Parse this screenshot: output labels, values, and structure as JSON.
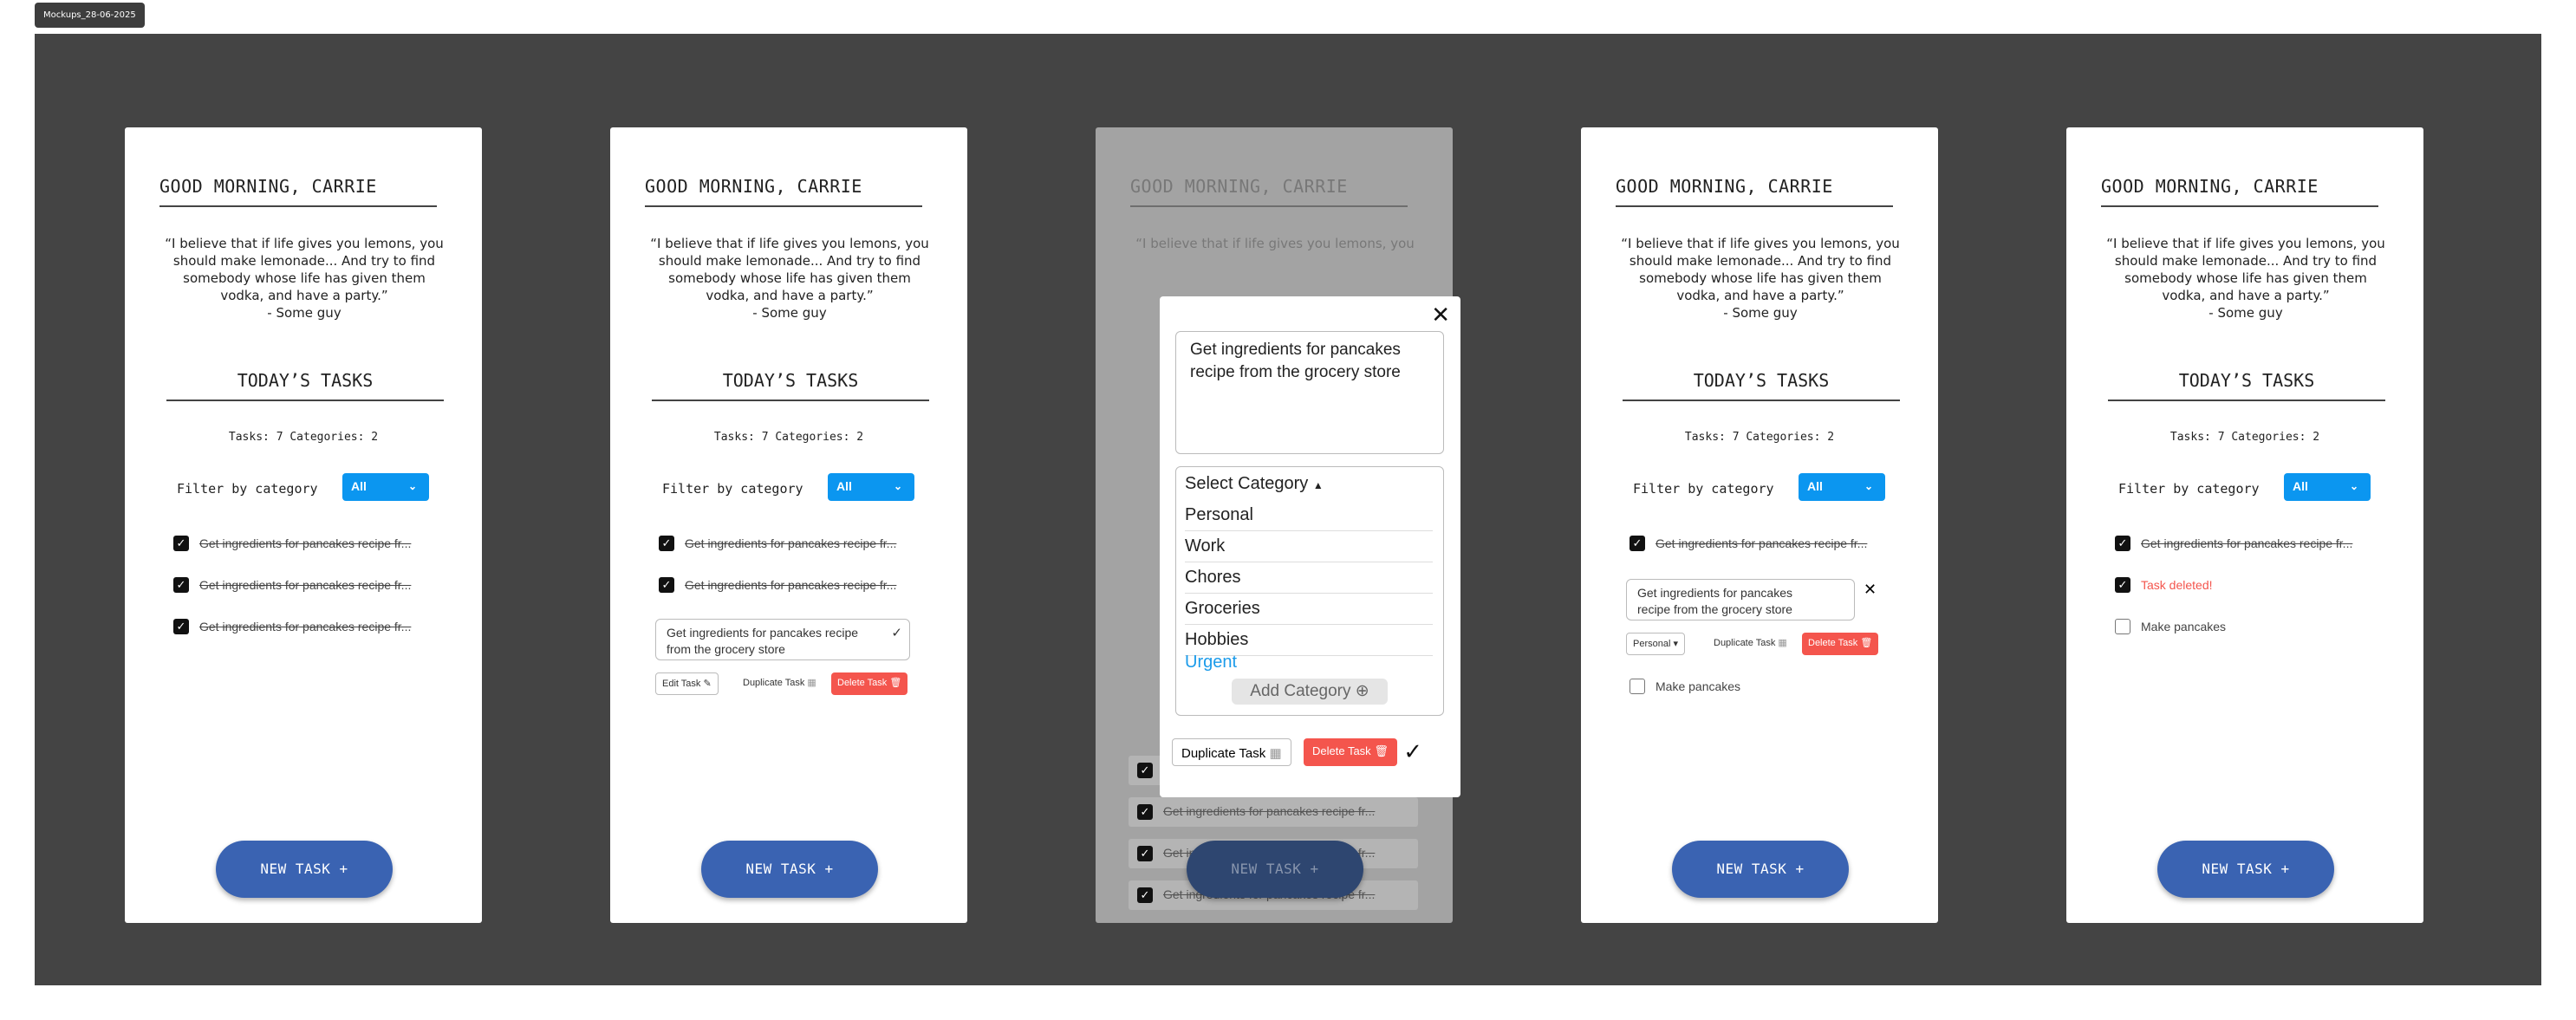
{
  "board_tag": "Mockups_28-06-2025",
  "greeting": "GOOD MORNING, CARRIE",
  "quote_lines": [
    "“I believe that if life gives you lemons, you",
    "should make lemonade... And try to find",
    "somebody whose life has given them",
    "vodka, and have a party.”",
    "- Some guy"
  ],
  "todays_tasks": "TODAY’S TASKS",
  "counts": "Tasks: 7 Categories: 2",
  "filter_label": "Filter by category",
  "filter_value": "All",
  "task_truncated": "Get ingredients for pancakes recipe fr...",
  "task_full_line1": "Get ingredients for pancakes recipe",
  "task_full_line2": "from the grocery store",
  "task_full_line1b": "Get ingredients for pancakes",
  "task_full_line2b": "recipe from the grocery store",
  "new_task": "NEW TASK +",
  "edit_task": "Edit Task",
  "duplicate_task": "Duplicate Task",
  "delete_task": "Delete Task",
  "category_personal": "Personal",
  "make_pancakes": "Make pancakes",
  "task_deleted": "Task deleted!",
  "modal": {
    "text_line1": "Get ingredients for pancakes",
    "text_line2": "recipe from the grocery store",
    "select_category": "Select Category",
    "categories": [
      "Personal",
      "Work",
      "Chores",
      "Groceries",
      "Hobbies",
      "Urgent"
    ],
    "add_category": "Add Category"
  },
  "colors": {
    "accent": "#3a63b2",
    "filter": "#0b96f0",
    "danger": "#f4554d",
    "urgent": "#1b9bea"
  }
}
